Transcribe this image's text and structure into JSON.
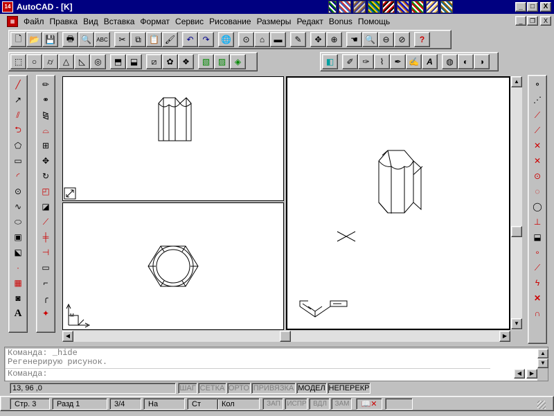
{
  "title": "AutoCAD - [K]",
  "title_icon": "14",
  "menu": [
    "Файл",
    "Правка",
    "Вид",
    "Вставка",
    "Формат",
    "Сервис",
    "Рисование",
    "Размеры",
    "Редакт",
    "Bonus",
    "Помощь"
  ],
  "window_buttons": {
    "minimize": "_",
    "maximize": "□",
    "close": "X"
  },
  "mdi_buttons": {
    "minimize": "_",
    "restore": "❐",
    "close": "X"
  },
  "command": {
    "history": [
      "Команда: _hide",
      "Регенерирую рисунок."
    ],
    "prompt": "Команда:"
  },
  "status": {
    "coords": "13, 96 ,0",
    "toggles": [
      {
        "label": "ШАГ",
        "on": false
      },
      {
        "label": "СЕТКА",
        "on": false
      },
      {
        "label": "ОРТО",
        "on": false
      },
      {
        "label": "ПРИВЯЗКА",
        "on": false
      },
      {
        "label": "МОДЕЛ",
        "on": true
      },
      {
        "label": "НЕПЕРЕКР",
        "on": true
      }
    ]
  },
  "bottom": {
    "page": "Стр.  3",
    "section": "Разд  1",
    "pages": "3/4",
    "at": "На",
    "line": "Ст",
    "col": "Кол",
    "flags": [
      "ЗАП",
      "ИСПР",
      "ВДЛ",
      "ЗАМ"
    ]
  },
  "colors": {
    "titlebar": "#000080",
    "face": "#c0c0c0",
    "viewport": "#ffffff",
    "close_icon": "#cc0000",
    "help_icon": "#cc0000"
  }
}
